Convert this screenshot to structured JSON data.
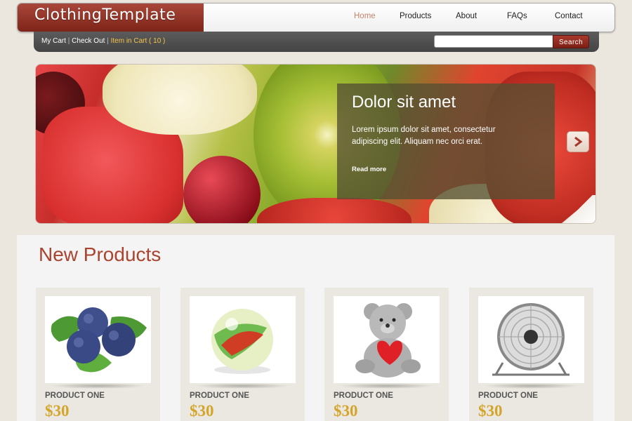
{
  "header": {
    "logo": "ClothingTemplate",
    "nav": [
      {
        "label": "Home",
        "active": true
      },
      {
        "label": "Products",
        "active": false
      },
      {
        "label": "About",
        "active": false
      },
      {
        "label": "FAQs",
        "active": false
      },
      {
        "label": "Contact",
        "active": false
      }
    ]
  },
  "subbar": {
    "my_cart": "My Cart",
    "separator": "|",
    "check_out": "Check Out",
    "item_in_cart": "Item in Cart ( 10 )",
    "search_value": "",
    "search_button": "Search"
  },
  "slider": {
    "title": "Dolor sit amet",
    "body": "Lorem ipsum dolor sit amet, consectetur adipiscing elit. Aliquam nec orci erat.",
    "link": "Read more",
    "next_icon": "chevron-right-icon"
  },
  "products": {
    "title": "New Products",
    "items": [
      {
        "name": "PRODUCT ONE",
        "price": "$30",
        "image": "blueberries-image"
      },
      {
        "name": "PRODUCT ONE",
        "price": "$30",
        "image": "marble-image"
      },
      {
        "name": "PRODUCT ONE",
        "price": "$30",
        "image": "teddy-bear-image"
      },
      {
        "name": "PRODUCT ONE",
        "price": "$30",
        "image": "desk-fan-image"
      }
    ]
  },
  "colors": {
    "brand": "#8c2f22",
    "accent_price": "#d4a52b",
    "nav_active": "#c7826a",
    "cart_highlight": "#f6c447"
  }
}
